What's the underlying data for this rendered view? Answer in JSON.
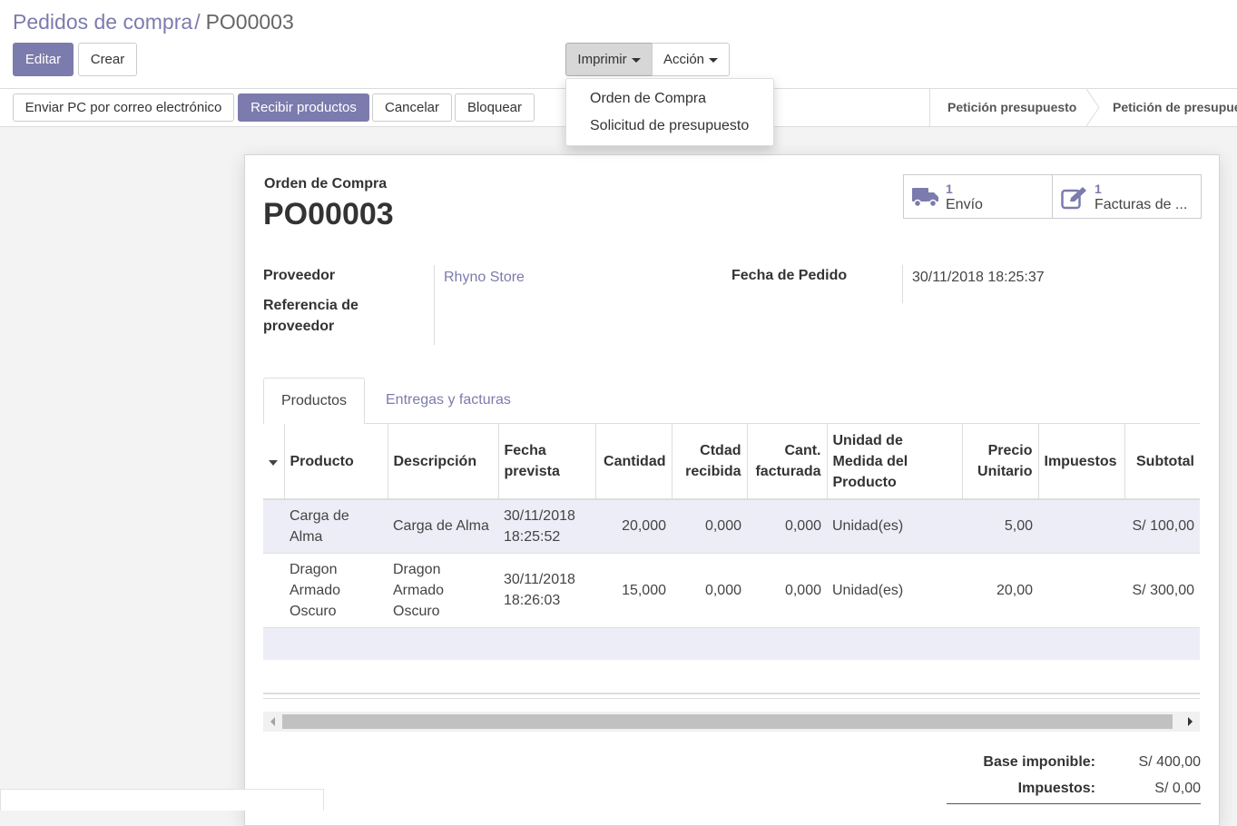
{
  "breadcrumb": {
    "parent": "Pedidos de compra",
    "separator": "/",
    "current": "PO00003"
  },
  "toolbar": {
    "edit_label": "Editar",
    "create_label": "Crear",
    "print_label": "Imprimir",
    "action_label": "Acción"
  },
  "print_menu": {
    "items": [
      "Orden de Compra",
      "Solicitud de presupuesto"
    ]
  },
  "statusbar": {
    "buttons": {
      "send_email": "Enviar PC por correo electrónico",
      "receive": "Recibir productos",
      "cancel": "Cancelar",
      "lock": "Bloquear"
    },
    "stages": [
      "Petición presupuesto",
      "Petición de presupue"
    ]
  },
  "smart_buttons": {
    "shipment": {
      "count": "1",
      "label": "Envío",
      "icon": "truck-icon"
    },
    "bills": {
      "count": "1",
      "label": "Facturas de ...",
      "icon": "pencil-square-icon"
    }
  },
  "form": {
    "doc_label": "Orden de Compra",
    "doc_name": "PO00003",
    "vendor_label": "Proveedor",
    "vendor_value": "Rhyno Store",
    "vendor_ref_label": "Referencia de proveedor",
    "order_date_label": "Fecha de Pedido",
    "order_date_value": "30/11/2018 18:25:37"
  },
  "tabs": [
    "Productos",
    "Entregas y facturas"
  ],
  "lines_table": {
    "headers": [
      "Producto",
      "Descripción",
      "Fecha prevista",
      "Cantidad",
      "Ctdad recibida",
      "Cant. facturada",
      "Unidad de Medida del Producto",
      "Precio Unitario",
      "Impuestos",
      "Subtotal"
    ],
    "rows": [
      [
        "Carga de Alma",
        "Carga de Alma",
        "30/11/2018 18:25:52",
        "20,000",
        "0,000",
        "0,000",
        "Unidad(es)",
        "5,00",
        "",
        "S/ 100,00"
      ],
      [
        "Dragon Armado Oscuro",
        "Dragon Armado Oscuro",
        "30/11/2018 18:26:03",
        "15,000",
        "0,000",
        "0,000",
        "Unidad(es)",
        "20,00",
        "",
        "S/ 300,00"
      ]
    ]
  },
  "totals": {
    "untaxed_label": "Base imponible:",
    "untaxed_value": "S/ 400,00",
    "taxes_label": "Impuestos:",
    "taxes_value": "S/ 0,00"
  },
  "colors": {
    "brand": "#7c7bad",
    "row_highlight": "#ededf7",
    "background": "#f3f3f3"
  }
}
